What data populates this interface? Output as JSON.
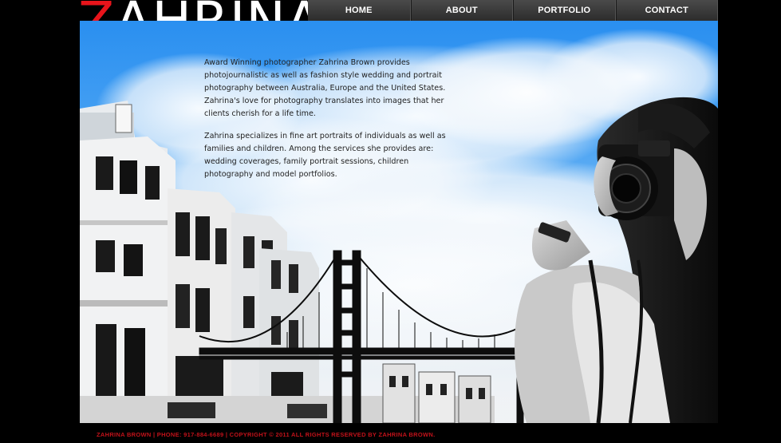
{
  "logo": {
    "first_letter": "Z",
    "rest": "AHRINA"
  },
  "nav": {
    "items": [
      {
        "label": "HOME"
      },
      {
        "label": "ABOUT"
      },
      {
        "label": "PORTFOLIO"
      },
      {
        "label": "CONTACT"
      }
    ]
  },
  "about": {
    "paragraph_1": "Award Winning photographer Zahrina Brown provides photojournalistic as well as fashion style wedding and portrait photography between Australia, Europe and the United States. Zahrina's love for photography translates into images that her clients cherish for a life time.",
    "paragraph_2": "Zahrina specializes in fine art portraits of individuals as well as families and children. Among the services she provides are: wedding coverages, family portrait sessions, children photography and model portfolios."
  },
  "footer": {
    "text": "ZAHRINA BROWN | PHONE: 917-884-6689 | COPYRIGHT © 2011 ALL RIGHTS RESERVED BY ZAHRINA BROWN."
  },
  "colors": {
    "background": "#000000",
    "brand_red": "#e8141b",
    "sky_blue": "#2a8ff0",
    "nav_bg": "#3a3a3a"
  }
}
